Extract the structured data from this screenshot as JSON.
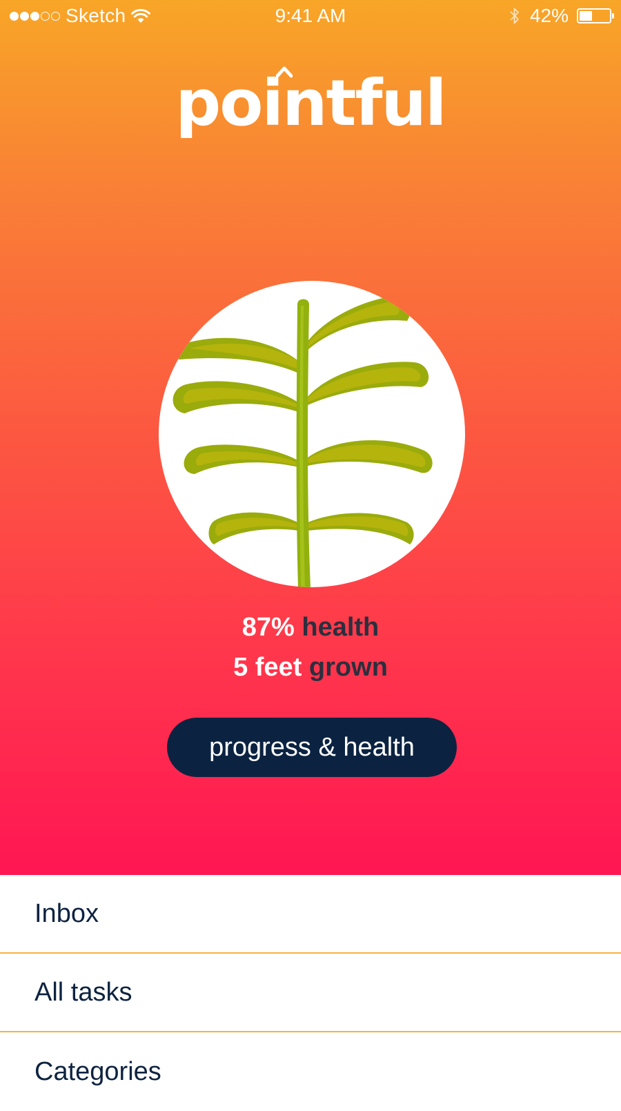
{
  "status_bar": {
    "carrier": "Sketch",
    "time": "9:41 AM",
    "battery_percent": "42%",
    "battery_level": 0.42,
    "signal_dots_filled": 3,
    "signal_dots_total": 5
  },
  "app": {
    "logo": "pointful"
  },
  "stats": {
    "health_value": "87%",
    "health_label": "health",
    "grown_value": "5 feet",
    "grown_label": "grown"
  },
  "progress_button": {
    "label": "progress & health"
  },
  "menu": {
    "items": [
      {
        "label": "Inbox"
      },
      {
        "label": "All tasks"
      },
      {
        "label": "Categories"
      }
    ]
  },
  "colors": {
    "gradient_top": "#f8a627",
    "gradient_bottom": "#ff1653",
    "button_bg": "#0b2341",
    "divider": "#f7b23a",
    "menu_text": "#0e2340",
    "stat_label": "#2b2f3e"
  }
}
